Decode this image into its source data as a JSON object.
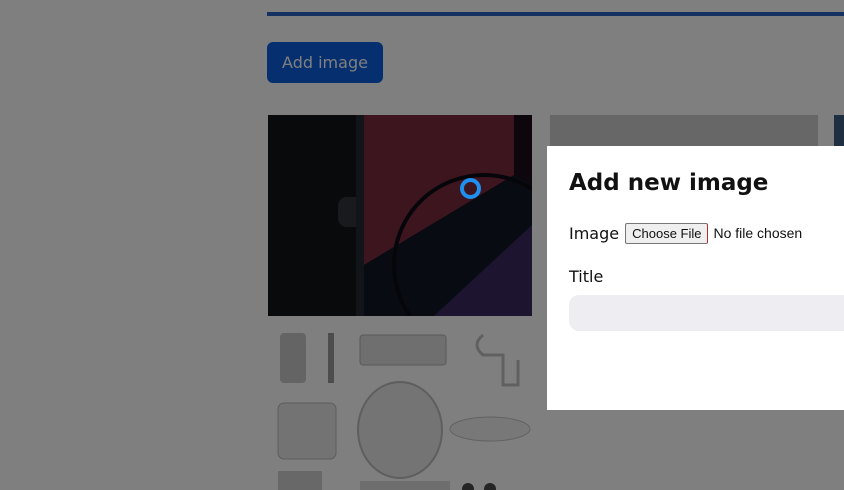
{
  "page": {
    "add_button_label": "Add image",
    "accent_color": "#0d5fe0"
  },
  "modal": {
    "title": "Add new image",
    "image_label": "Image",
    "file_button_label": "Choose File",
    "file_status": "No file chosen",
    "title_label": "Title",
    "title_value": ""
  },
  "gallery": {
    "items": [
      {
        "subject": "iPhone product photo"
      },
      {
        "subject": "grey product photo"
      },
      {
        "subject": "Apple accessories photo"
      }
    ]
  },
  "cursor": {
    "icon": "cursor-ring-icon",
    "color": "#1f8ff0"
  }
}
